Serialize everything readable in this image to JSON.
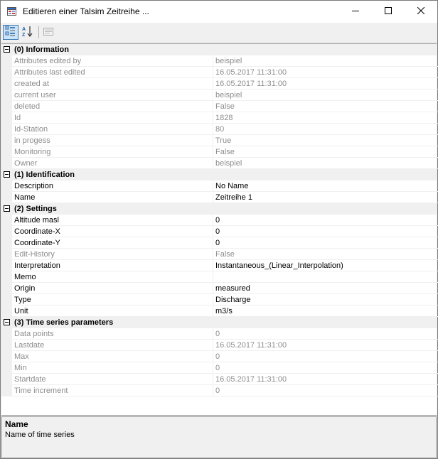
{
  "window": {
    "title": "Editieren einer Talsim Zeitreihe ...",
    "app_icon": "form-app-icon",
    "controls": {
      "minimize": "minimize-icon",
      "maximize": "maximize-icon",
      "close": "close-icon"
    }
  },
  "toolbar": {
    "buttons": [
      {
        "name": "categorized",
        "icon": "categorized-view-icon",
        "active": true
      },
      {
        "name": "alphabetical",
        "icon": "sort-az-icon",
        "active": false
      },
      {
        "name": "property-pages",
        "icon": "property-pages-icon",
        "active": false,
        "disabled": true
      }
    ]
  },
  "grid": {
    "categories": [
      {
        "label": "(0) Information",
        "properties": [
          {
            "name": "Attributes edited by",
            "value": "beispiel",
            "readonly": true
          },
          {
            "name": "Attributes last edited",
            "value": "16.05.2017 11:31:00",
            "readonly": true
          },
          {
            "name": "created at",
            "value": "16.05.2017 11:31:00",
            "readonly": true
          },
          {
            "name": "current user",
            "value": "beispiel",
            "readonly": true
          },
          {
            "name": "deleted",
            "value": "False",
            "readonly": true
          },
          {
            "name": "Id",
            "value": "1828",
            "readonly": true
          },
          {
            "name": "Id-Station",
            "value": "80",
            "readonly": true
          },
          {
            "name": "in progess",
            "value": "True",
            "readonly": true
          },
          {
            "name": "Monitoring",
            "value": "False",
            "readonly": true
          },
          {
            "name": "Owner",
            "value": "beispiel",
            "readonly": true
          }
        ]
      },
      {
        "label": "(1) Identification",
        "properties": [
          {
            "name": "Description",
            "value": "No Name",
            "readonly": false
          },
          {
            "name": "Name",
            "value": "Zeitreihe 1",
            "readonly": false
          }
        ]
      },
      {
        "label": "(2) Settings",
        "properties": [
          {
            "name": "Altitude masl",
            "value": "0",
            "readonly": false
          },
          {
            "name": "Coordinate-X",
            "value": "0",
            "readonly": false
          },
          {
            "name": "Coordinate-Y",
            "value": "0",
            "readonly": false
          },
          {
            "name": "Edit-History",
            "value": "False",
            "readonly": true
          },
          {
            "name": "Interpretation",
            "value": "Instantaneous_(Linear_Interpolation)",
            "readonly": false
          },
          {
            "name": "Memo",
            "value": "",
            "readonly": false
          },
          {
            "name": "Origin",
            "value": "measured",
            "readonly": false
          },
          {
            "name": "Type",
            "value": "Discharge",
            "readonly": false
          },
          {
            "name": "Unit",
            "value": "m3/s",
            "readonly": false
          }
        ]
      },
      {
        "label": "(3) Time series parameters",
        "properties": [
          {
            "name": "Data points",
            "value": "0",
            "readonly": true
          },
          {
            "name": "Lastdate",
            "value": "16.05.2017 11:31:00",
            "readonly": true
          },
          {
            "name": "Max",
            "value": "0",
            "readonly": true
          },
          {
            "name": "Min",
            "value": "0",
            "readonly": true
          },
          {
            "name": "Startdate",
            "value": "16.05.2017 11:31:00",
            "readonly": true
          },
          {
            "name": "Time increment",
            "value": "0",
            "readonly": true
          }
        ]
      }
    ]
  },
  "help": {
    "title": "Name",
    "description": "Name of time series"
  }
}
